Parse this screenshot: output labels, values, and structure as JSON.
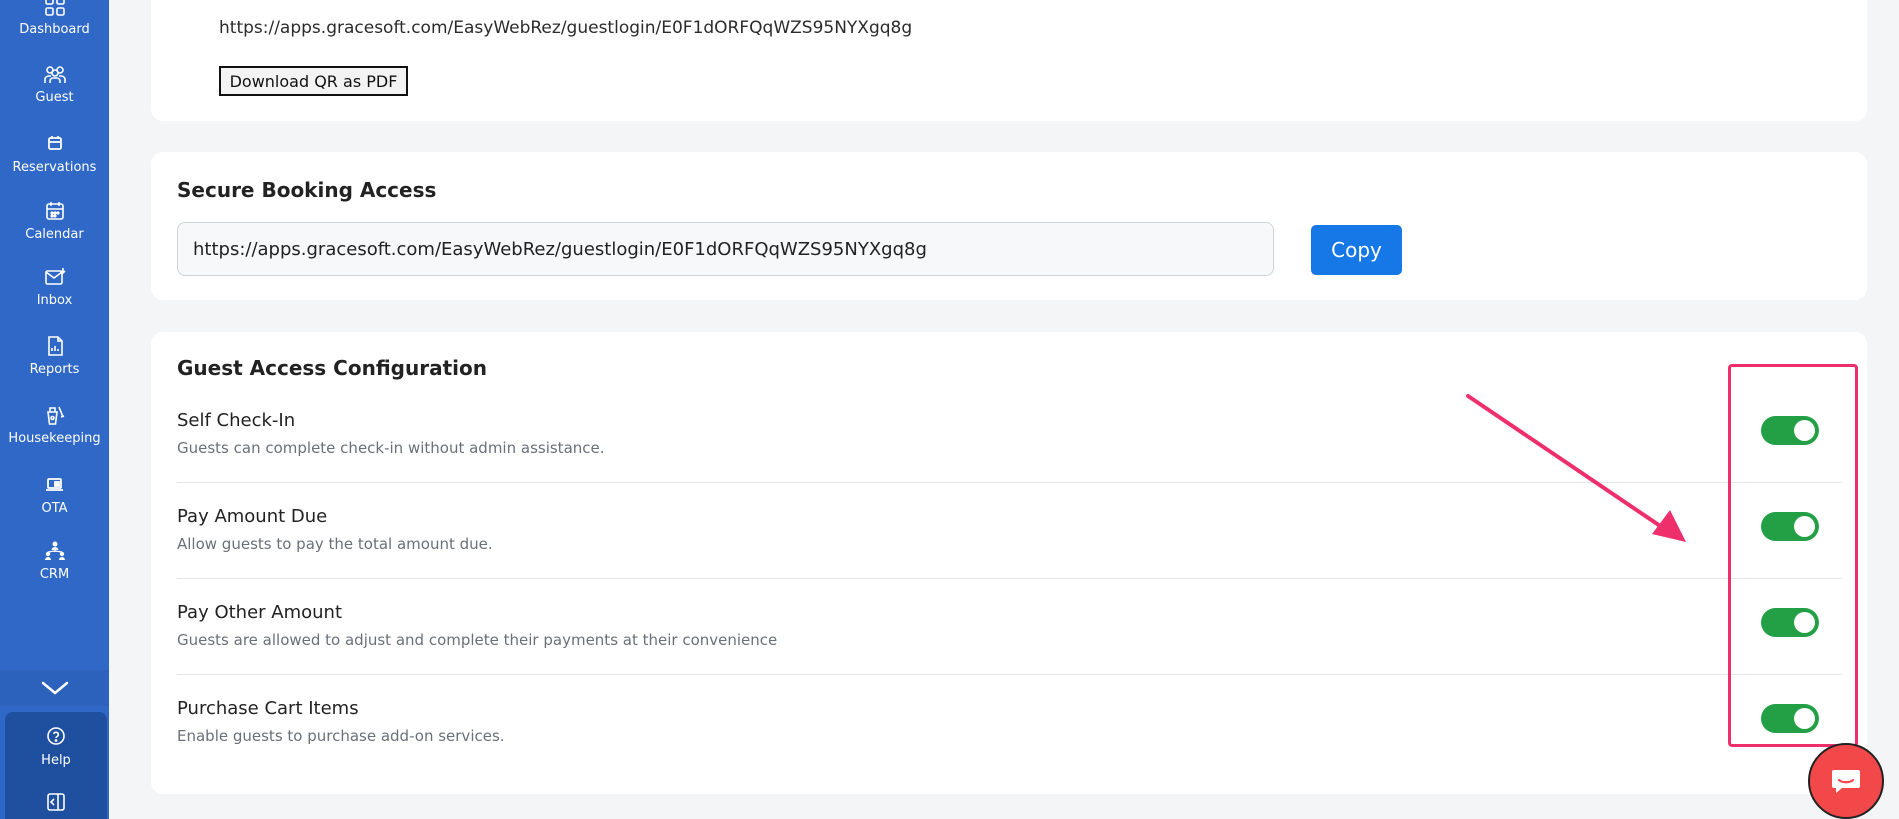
{
  "sidebar": {
    "items": [
      {
        "label": "Dashboard",
        "icon": "dashboard-icon"
      },
      {
        "label": "Guest",
        "icon": "guest-icon"
      },
      {
        "label": "Reservations",
        "icon": "reservations-icon"
      },
      {
        "label": "Calendar",
        "icon": "calendar-icon"
      },
      {
        "label": "Inbox",
        "icon": "inbox-icon"
      },
      {
        "label": "Reports",
        "icon": "reports-icon"
      },
      {
        "label": "Housekeeping",
        "icon": "housekeeping-icon"
      },
      {
        "label": "OTA",
        "icon": "ota-icon"
      },
      {
        "label": "CRM",
        "icon": "crm-icon"
      }
    ],
    "bottom": {
      "help_label": "Help"
    }
  },
  "qr_section": {
    "url": "https://apps.gracesoft.com/EasyWebRez/guestlogin/E0F1dORFQqWZS95NYXgq8g",
    "download_label": "Download QR as PDF"
  },
  "secure_booking": {
    "title": "Secure Booking Access",
    "url_value": "https://apps.gracesoft.com/EasyWebRez/guestlogin/E0F1dORFQqWZS95NYXgq8g",
    "copy_label": "Copy"
  },
  "guest_access": {
    "title": "Guest Access Configuration",
    "options": [
      {
        "title": "Self Check-In",
        "description": "Guests can complete check-in without admin assistance.",
        "enabled": true
      },
      {
        "title": "Pay Amount Due",
        "description": "Allow guests to pay the total amount due.",
        "enabled": true
      },
      {
        "title": "Pay Other Amount",
        "description": "Guests are allowed to adjust and complete their payments at their convenience",
        "enabled": true
      },
      {
        "title": "Purchase Cart Items",
        "description": "Enable guests to purchase add-on services.",
        "enabled": true
      }
    ]
  },
  "colors": {
    "sidebar": "#2f68c6",
    "accent": "#1677e6",
    "toggle_on": "#23a046",
    "highlight": "#ee2f6c",
    "chat": "#f2484a"
  }
}
